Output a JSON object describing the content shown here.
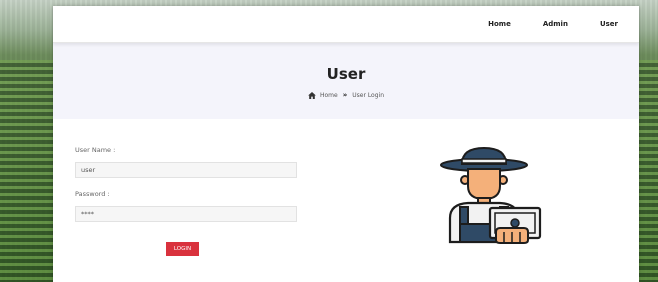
{
  "nav": {
    "home": "Home",
    "admin": "Admin",
    "user": "User"
  },
  "banner": {
    "title": "User",
    "breadcrumb_home": "Home",
    "breadcrumb_sep": "»",
    "breadcrumb_current": "User Login"
  },
  "form": {
    "username_label": "User Name :",
    "username_value": "user",
    "password_label": "Password :",
    "password_value": "****",
    "login_label": "LOGIN"
  },
  "colors": {
    "accent": "#d9323d",
    "banner_bg": "#f4f4fb"
  },
  "icons": {
    "breadcrumb": "home-icon",
    "illustration": "farmer-laptop-icon"
  }
}
